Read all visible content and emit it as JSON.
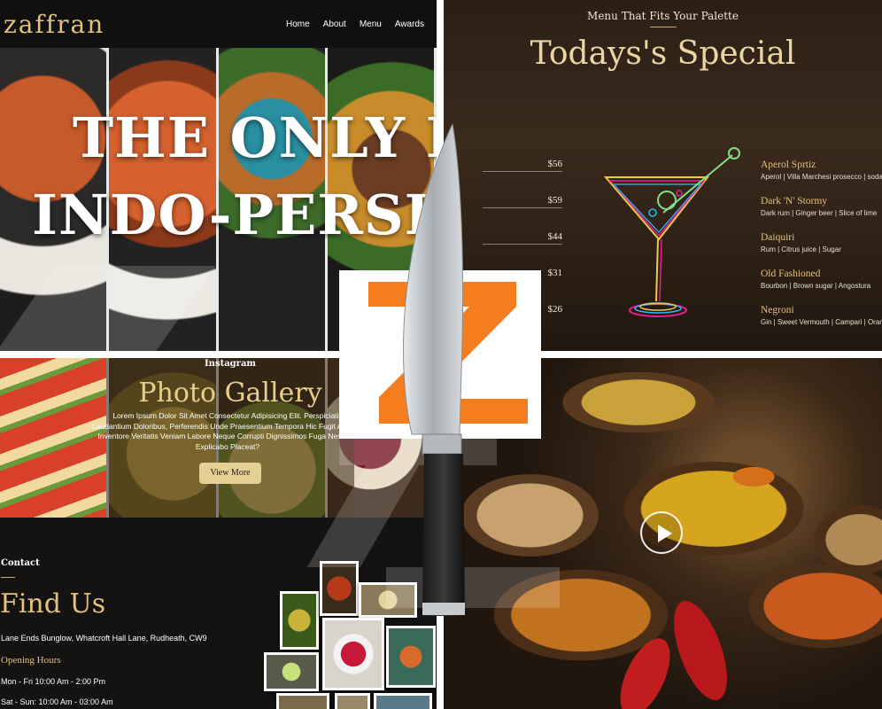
{
  "hero": {
    "logo": "zaffran",
    "nav": [
      "Home",
      "About",
      "Menu",
      "Awards"
    ],
    "headline_line1": "THE ONLY PL",
    "headline_line2": "INDO-PERSI"
  },
  "specials": {
    "eyebrow": "Menu That Fits Your Palette",
    "title": "Todays's Special",
    "items": [
      {
        "price": "$56",
        "name": "Aperol Sprtiz",
        "desc": "Aperol | Villa Marchesi prosecco | soda"
      },
      {
        "price": "$59",
        "name": "Dark 'N' Stormy",
        "desc": "Dark rum | Ginger beer | Slice of lime"
      },
      {
        "price": "$44",
        "name": "Daiquiri",
        "desc": "Rum | Citrus juice | Sugar"
      },
      {
        "price": "$31",
        "name": "Old Fashioned",
        "desc": "Bourbon | Brown sugar | Angostura"
      },
      {
        "price": "$26",
        "name": "Negroni",
        "desc": "Gin | Sweet Vermouth | Campari | Orange"
      }
    ]
  },
  "gallery": {
    "eyebrow": "Instagram",
    "title": "Photo Gallery",
    "copy": "Lorem Ipsum Dolor Sit Amet Consectetur Adipisicing Elit. Perspiciatis Laudantium Doloribus, Perferendis Unde Praesentium Tempora Hic Fugit Adipisci Inventore Veritatis Veniam Labore Neque Corrupti Dignissimos Fuga Nesciunt Explicabo Placeat?",
    "button": "View More"
  },
  "contact": {
    "eyebrow": "Contact",
    "title": "Find Us",
    "address": "Lane Ends Bunglow, Whatcroft Hall Lane, Rudheath, CW9",
    "hours_title": "Opening Hours",
    "hours_weekday": "Mon - Fri 10:00 Am - 2:00 Pm",
    "hours_weekend": "Sat - Sun: 10:00 Am - 03:00 Am"
  },
  "colors": {
    "brand_orange": "#f47d20",
    "gold": "#e3c27a",
    "dark": "#141312"
  },
  "icons": {
    "play": "play-icon",
    "brand_mark": "z-logo-icon"
  }
}
